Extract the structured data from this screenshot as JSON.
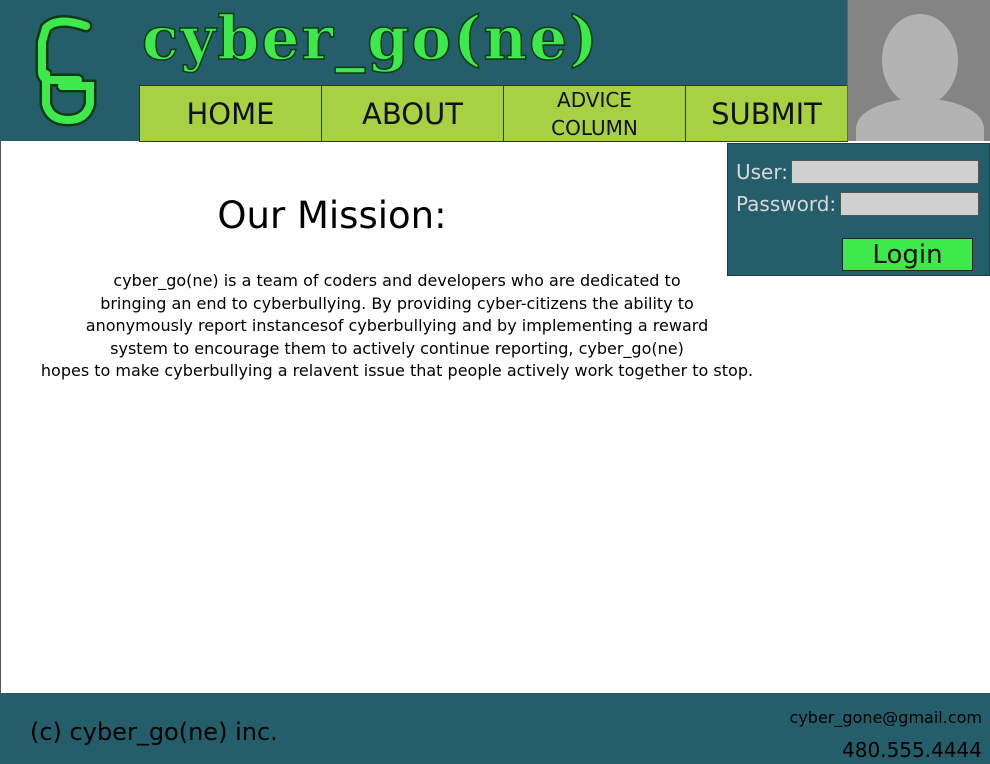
{
  "header": {
    "site_title": "cyber_go(ne)",
    "logo_icon": "cg-monogram-icon",
    "avatar_icon": "user-silhouette-icon"
  },
  "nav": {
    "items": [
      {
        "label": "HOME"
      },
      {
        "label": "ABOUT"
      },
      {
        "label": "ADVICE\nCOLUMN"
      },
      {
        "label": "SUBMIT"
      }
    ]
  },
  "login": {
    "user_label": "User:",
    "password_label": "Password:",
    "user_value": "",
    "password_value": "",
    "button_label": "Login"
  },
  "main": {
    "title": "Our Mission:",
    "paragraph_lines": [
      "cyber_go(ne) is a team of coders and developers who are dedicated to",
      "bringing an end to cyberbullying. By providing cyber-citizens the ability to",
      "anonymously report instancesof cyberbullying and by implementing a reward",
      "system to encourage them to actively continue reporting, cyber_go(ne)",
      "hopes to make cyberbullying a relavent issue that people actively work together to stop."
    ]
  },
  "footer": {
    "copyright": "(c) cyber_go(ne) inc.",
    "email": "cyber_gone@gmail.com",
    "phone": "480.555.4444"
  },
  "colors": {
    "header_bg": "#245e6a",
    "accent_green": "#3ee94b",
    "nav_green": "#a8d043",
    "avatar_bg": "#848484"
  }
}
